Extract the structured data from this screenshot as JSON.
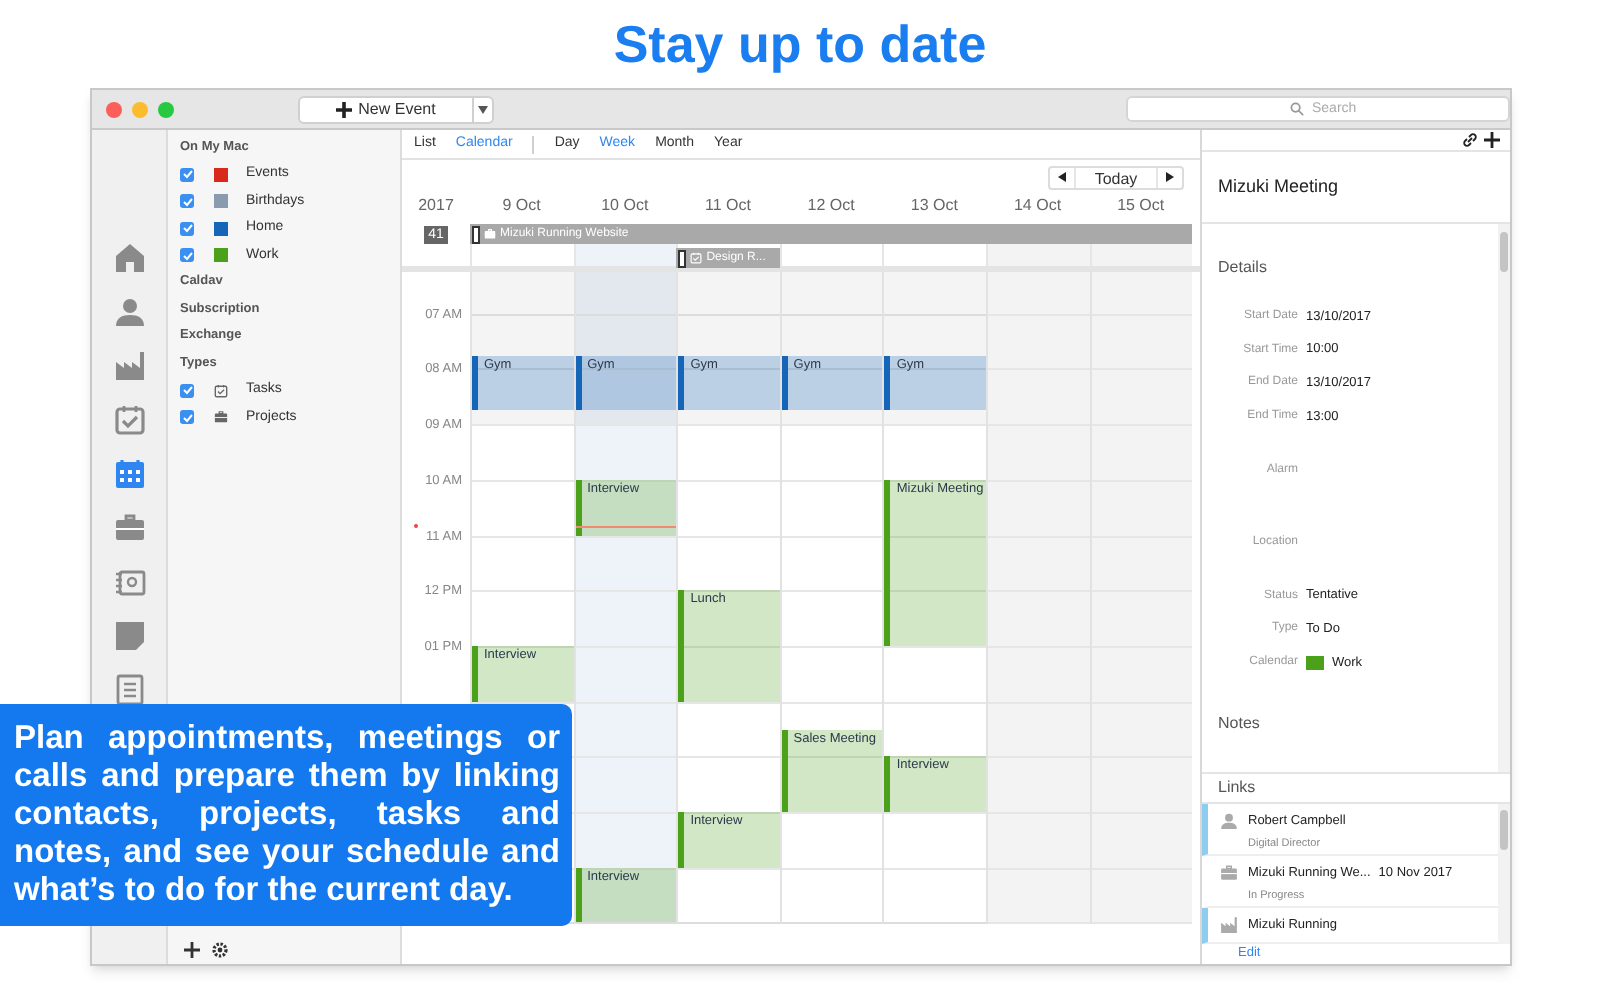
{
  "headline": "Stay up to date",
  "toolbar": {
    "new_event": "New Event",
    "search": {
      "placeholder": "Search"
    }
  },
  "rail": [
    {
      "selected": false
    },
    {
      "selected": false
    },
    {
      "selected": false
    },
    {
      "selected": false
    },
    {
      "selected": true
    },
    {
      "selected": false
    },
    {
      "selected": false
    },
    {
      "selected": false
    },
    {
      "selected": false
    }
  ],
  "sidebar": [
    {
      "kind": "header",
      "label": "On My Mac"
    },
    {
      "kind": "calendar",
      "label": "Events",
      "checked": true,
      "color": "#d9291c"
    },
    {
      "kind": "calendar",
      "label": "Birthdays",
      "checked": true,
      "color": "#8a9bb0"
    },
    {
      "kind": "calendar",
      "label": "Home",
      "checked": true,
      "color": "#1565b8"
    },
    {
      "kind": "calendar",
      "label": "Work",
      "checked": true,
      "color": "#4ca11a"
    },
    {
      "kind": "header",
      "label": "Caldav"
    },
    {
      "kind": "header",
      "label": "Subscription"
    },
    {
      "kind": "header",
      "label": "Exchange"
    },
    {
      "kind": "header",
      "label": "Types"
    },
    {
      "kind": "type",
      "label": "Tasks",
      "checked": true
    },
    {
      "kind": "type",
      "label": "Projects",
      "checked": true
    }
  ],
  "view_tabs": [
    {
      "label": "List",
      "selected": false
    },
    {
      "label": "Calendar",
      "selected": true
    }
  ],
  "range_tabs": [
    {
      "label": "Day",
      "selected": false
    },
    {
      "label": "Week",
      "selected": true
    },
    {
      "label": "Month",
      "selected": false
    },
    {
      "label": "Year",
      "selected": false
    }
  ],
  "today_button": "Today",
  "year": "2017",
  "week_number": "41",
  "days": [
    {
      "label": "9 Oct",
      "today": false,
      "weekend": false,
      "events": [
        {
          "title": "Gym",
          "color": "#1565b8"
        },
        {
          "title": "Interview",
          "color": "#4ca11a"
        }
      ]
    },
    {
      "label": "10 Oct",
      "today": true,
      "weekend": false,
      "events": [
        {
          "title": "Gym",
          "color": "#1565b8"
        },
        {
          "title": "Interview",
          "color": "#4ca11a"
        },
        {
          "title": "Interview",
          "color": "#4ca11a"
        }
      ]
    },
    {
      "label": "11 Oct",
      "today": false,
      "weekend": false,
      "events": [
        {
          "title": "Gym",
          "color": "#1565b8"
        },
        {
          "title": "Lunch",
          "color": "#4ca11a"
        },
        {
          "title": "Interview",
          "color": "#4ca11a"
        }
      ]
    },
    {
      "label": "12 Oct",
      "today": false,
      "weekend": false,
      "events": [
        {
          "title": "Gym",
          "color": "#1565b8"
        },
        {
          "title": "Sales Meeting",
          "color": "#4ca11a"
        }
      ]
    },
    {
      "label": "13 Oct",
      "today": false,
      "weekend": false,
      "events": [
        {
          "title": "Gym",
          "color": "#1565b8"
        },
        {
          "title": "Mizuki Meeting",
          "color": "#4ca11a"
        },
        {
          "title": "Interview",
          "color": "#4ca11a"
        }
      ]
    },
    {
      "label": "14 Oct",
      "today": false,
      "weekend": true
    },
    {
      "label": "15 Oct",
      "today": false,
      "weekend": true
    }
  ],
  "all_day": [
    {
      "title": "Mizuki Running Website",
      "kind": "project"
    },
    {
      "title": "Design R...",
      "kind": "task"
    }
  ],
  "hours": [
    "07 AM",
    "08 AM",
    "09 AM",
    "10 AM",
    "11 AM",
    "12 PM",
    "01 PM"
  ],
  "detail": {
    "title": "Mizuki Meeting",
    "section": "Details",
    "rows": [
      {
        "kind": "value",
        "label": "Start Date",
        "value": "13/10/2017"
      },
      {
        "kind": "value",
        "label": "Start Time",
        "value": "10:00"
      },
      {
        "kind": "value",
        "label": "End Date",
        "value": "13/10/2017"
      },
      {
        "kind": "value",
        "label": "End Time",
        "value": "13:00"
      },
      {
        "kind": "empty",
        "label": "Alarm"
      },
      {
        "kind": "empty",
        "label": "Location"
      },
      {
        "kind": "value",
        "label": "Status",
        "value": "Tentative"
      },
      {
        "kind": "value",
        "label": "Type",
        "value": "To Do"
      },
      {
        "kind": "calendar",
        "label": "Calendar",
        "value": "Work",
        "color": "#4ca11a"
      }
    ],
    "notes": "Notes",
    "links_title": "Links",
    "links": [
      {
        "title": "Robert Campbell",
        "subtitle": "Digital Director",
        "marked": true
      },
      {
        "title": "Mizuki Running We...",
        "date": "10 Nov 2017",
        "subtitle": "In Progress",
        "marked": false
      },
      {
        "title": "Mizuki Running",
        "marked": true
      }
    ],
    "edit": "Edit"
  },
  "callout": "Plan appointments, meetings or calls and prepare them by linking contacts, projects, tasks and notes, and see your schedule and what’s to do for the current day."
}
